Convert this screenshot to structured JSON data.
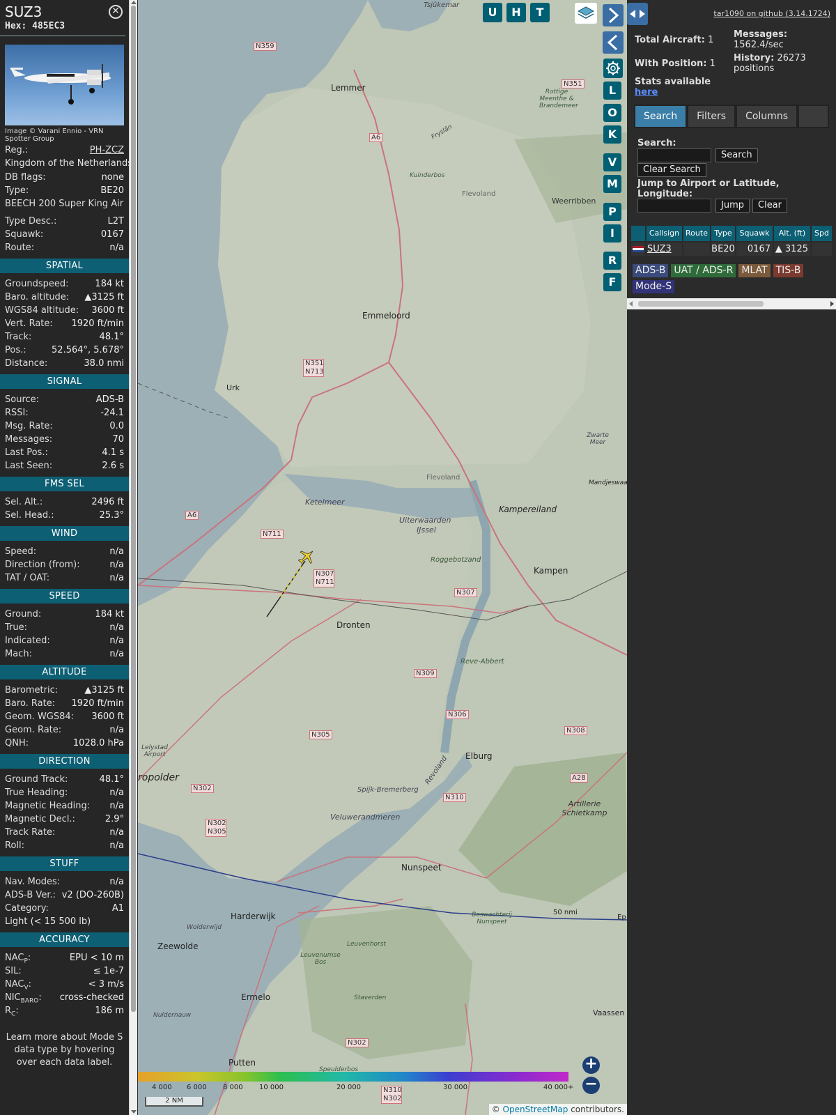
{
  "sidebar": {
    "callsign": "SUZ3",
    "hex_label": "Hex:",
    "hex": "485EC3",
    "close_icon": "circle-x-icon",
    "photo_credit": "Image © Varani Ennio - VRN Spotter Group",
    "reg_label": "Reg.:",
    "reg": "PH-ZCZ",
    "country": "Kingdom of the Netherlands",
    "dbflags_label": "DB flags:",
    "dbflags": "none",
    "type_label": "Type:",
    "type": "BE20",
    "type_full": "BEECH 200 Super King Air",
    "typedesc_label": "Type Desc.:",
    "typedesc": "L2T",
    "squawk_label": "Squawk:",
    "squawk": "0167",
    "route_label": "Route:",
    "route": "n/a",
    "sections": {
      "spatial": "SPATIAL",
      "signal": "SIGNAL",
      "fms": "FMS SEL",
      "wind": "WIND",
      "speed": "SPEED",
      "altitude": "ALTITUDE",
      "direction": "DIRECTION",
      "stuff": "STUFF",
      "accuracy": "ACCURACY"
    },
    "spatial": [
      {
        "k": "Groundspeed:",
        "v": "184 kt"
      },
      {
        "k": "Baro. altitude:",
        "v": "▲3125 ft"
      },
      {
        "k": "WGS84 altitude:",
        "v": "3600 ft"
      },
      {
        "k": "Vert. Rate:",
        "v": "1920 ft/min"
      },
      {
        "k": "Track:",
        "v": "48.1°"
      },
      {
        "k": "Pos.:",
        "v": "52.564°, 5.678°"
      },
      {
        "k": "Distance:",
        "v": "38.0 nmi"
      }
    ],
    "signal": [
      {
        "k": "Source:",
        "v": "ADS-B"
      },
      {
        "k": "RSSI:",
        "v": "-24.1"
      },
      {
        "k": "Msg. Rate:",
        "v": "0.0"
      },
      {
        "k": "Messages:",
        "v": "70"
      },
      {
        "k": "Last Pos.:",
        "v": "4.1 s"
      },
      {
        "k": "Last Seen:",
        "v": "2.6 s"
      }
    ],
    "fms": [
      {
        "k": "Sel. Alt.:",
        "v": "2496 ft"
      },
      {
        "k": "Sel. Head.:",
        "v": "25.3°"
      }
    ],
    "wind": [
      {
        "k": "Speed:",
        "v": "n/a"
      },
      {
        "k": "Direction (from):",
        "v": "n/a"
      },
      {
        "k": "TAT / OAT:",
        "v": "n/a"
      }
    ],
    "speed": [
      {
        "k": "Ground:",
        "v": "184 kt"
      },
      {
        "k": "True:",
        "v": "n/a"
      },
      {
        "k": "Indicated:",
        "v": "n/a"
      },
      {
        "k": "Mach:",
        "v": "n/a"
      }
    ],
    "altitude": [
      {
        "k": "Barometric:",
        "v": "▲3125 ft"
      },
      {
        "k": "Baro. Rate:",
        "v": "1920 ft/min"
      },
      {
        "k": "Geom. WGS84:",
        "v": "3600 ft"
      },
      {
        "k": "Geom. Rate:",
        "v": "n/a"
      },
      {
        "k": "QNH:",
        "v": "1028.0 hPa"
      }
    ],
    "direction": [
      {
        "k": "Ground Track:",
        "v": "48.1°"
      },
      {
        "k": "True Heading:",
        "v": "n/a"
      },
      {
        "k": "Magnetic Heading:",
        "v": "n/a"
      },
      {
        "k": "Magnetic Decl.:",
        "v": "2.9°"
      },
      {
        "k": "Track Rate:",
        "v": "n/a"
      },
      {
        "k": "Roll:",
        "v": "n/a"
      }
    ],
    "stuff": [
      {
        "k": "Nav. Modes:",
        "v": "n/a"
      },
      {
        "k": "ADS-B Ver.:",
        "v": "v2 (DO-260B)"
      },
      {
        "k": "Category:",
        "v": "A1"
      }
    ],
    "category_desc": "Light (< 15 500 lb)",
    "accuracy": [
      {
        "k": "NAC",
        "sub": "P",
        "v": "EPU < 10 m"
      },
      {
        "k": "SIL:",
        "sub": "",
        "v": "≤ 1e-7"
      },
      {
        "k": "NAC",
        "sub": "V",
        "v": "< 3 m/s"
      },
      {
        "k": "NIC",
        "sub": "BARO",
        "v": "cross-checked"
      },
      {
        "k": "R",
        "sub": "C",
        "v": "186 m"
      }
    ],
    "learn_more": "Learn more about Mode S data type by hovering over each data label."
  },
  "map": {
    "top_buttons": [
      "U",
      "H",
      "T"
    ],
    "layers_icon": "layers-icon",
    "side_buttons": [
      "L",
      "O",
      "K",
      "V",
      "M",
      "P",
      "I",
      "R",
      "F"
    ],
    "gear_icon": "gear-icon",
    "place_labels": {
      "tsjukemar": "Tsjûkemar",
      "lemmer": "Lemmer",
      "emmeloord": "Emmeloord",
      "urk": "Urk",
      "kampereiland": "Kampereiland",
      "kampen": "Kampen",
      "dronten": "Dronten",
      "elburg": "Elburg",
      "nunspeet": "Nunspeet",
      "harderwijk": "Harderwijk",
      "zeewolde": "Zeewolde",
      "ermelo": "Ermelo",
      "putten": "Putten",
      "vaassen": "Vaassen",
      "weerribben": "Weerribben",
      "ketelmeer": "Ketelmeer",
      "flevoland": "Flevoland",
      "flevoland2": "Flevoland",
      "uiterwaarden": "Uiterwaarden",
      "ijssel": "IJssel",
      "roggebotzand": "Roggebotzand",
      "reve_abbert": "Reve-Abbert",
      "veluwerandmeren": "Veluwerandmeren",
      "spijk": "Spijk-Bremerberg",
      "revoland": "Revoland",
      "artillerie": "Artillerie Schietkamp",
      "polder": "ropolder",
      "lelystad_airport": "Lelystad Airport",
      "zwarte_meer": "Zwarte Meer",
      "mandjeswaard": "Mandjeswaard",
      "kuinderbos": "Kuinderbos",
      "rottige": "Rottige Meenthe & Brandemeer",
      "fryslan": "Fryslân",
      "leuvenhorst": "Leuvenhorst",
      "leuvenumse": "Leuvenumse Bos",
      "staverden": "Staverden",
      "wolderwijd": "Wolderwijd",
      "nuldernauw": "Nuldernauw",
      "speulderbos": "Speulderbos",
      "boswachterij": "Boswachterij Nunspeet",
      "ep": "Ep",
      "range_ring": "50 nmi"
    },
    "road_labels": {
      "n359": "N359",
      "n351": "N351",
      "a6": "A6",
      "a6b": "A6",
      "n351b": "N351",
      "n713": "N713",
      "n711": "N711",
      "n307": "N307",
      "n711b": "N711",
      "n307b": "N307",
      "n309": "N309",
      "n306": "N306",
      "n305": "N305",
      "n308": "N308",
      "a28": "A28",
      "n302": "N302",
      "n302b": "N302",
      "n305b": "N305",
      "n310": "N310",
      "n302c": "N302",
      "n310b": "N310",
      "n302d": "N302"
    },
    "altitude_scale": [
      "4 000",
      "6 000",
      "8 000",
      "10 000",
      "20 000",
      "30 000",
      "40 000+"
    ],
    "scale_bar": "2 NM",
    "zoom_in": "+",
    "zoom_out": "−",
    "attribution_prefix": "©",
    "attribution_link": "OpenStreetMap",
    "attribution_suffix": "contributors."
  },
  "panel": {
    "toggle_icon": "split-arrows-icon",
    "github_link": "tar1090 on github (3.14.1724)",
    "total_aircraft_label": "Total Aircraft:",
    "total_aircraft": "1",
    "with_position_label": "With Position:",
    "with_position": "1",
    "messages_label": "Messages:",
    "messages": "1562.4/sec",
    "history_label": "History:",
    "history": "26273 positions",
    "stats_label": "Stats available",
    "stats_link": "here",
    "tabs": [
      "Search",
      "Filters",
      "Columns"
    ],
    "search_label": "Search:",
    "search_button": "Search",
    "clear_search_button": "Clear Search",
    "jump_label": "Jump to Airport or Latitude, Longitude:",
    "jump_button": "Jump",
    "clear_button": "Clear",
    "table": {
      "columns": [
        "Callsign",
        "Route",
        "Type",
        "Squawk",
        "Alt. (ft)",
        "Spd"
      ],
      "rows": [
        {
          "callsign": "SUZ3",
          "route": "",
          "type": "BE20",
          "squawk": "0167",
          "alt": "▲ 3125",
          "spd": ""
        }
      ]
    },
    "legend": [
      {
        "label": "ADS-B",
        "color": "#3a4a7a"
      },
      {
        "label": "UAT / ADS-R",
        "color": "#2f6b3a"
      },
      {
        "label": "MLAT",
        "color": "#7a5a3a"
      },
      {
        "label": "TIS-B",
        "color": "#7a3a2f"
      },
      {
        "label": "Mode-S",
        "color": "#33337a"
      }
    ]
  }
}
